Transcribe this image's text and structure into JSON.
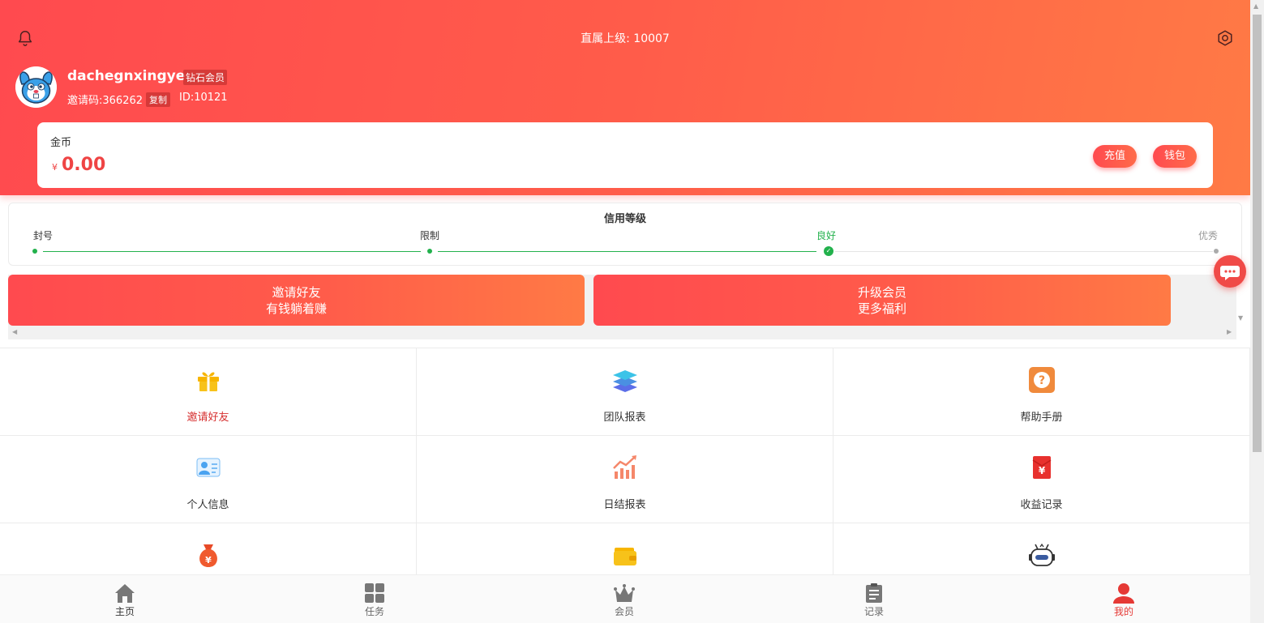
{
  "header": {
    "superior": "直属上级: 10007",
    "username": "dachegnxingye",
    "vip_badge": "钻石会员",
    "invite_code": "邀请码:366262",
    "copy_label": "复制",
    "user_id": "ID:10121"
  },
  "coin": {
    "label": "金币",
    "currency": "¥",
    "amount": "0.00",
    "recharge_label": "充值",
    "wallet_label": "钱包"
  },
  "credit": {
    "title": "信用等级",
    "levels": [
      "封号",
      "限制",
      "良好",
      "优秀"
    ],
    "current_level_index": 2
  },
  "banners": [
    {
      "line1": "邀请好友",
      "line2": "有钱躺着赚"
    },
    {
      "line1": "升级会员",
      "line2": "更多福利"
    }
  ],
  "menu": [
    {
      "label": "邀请好友",
      "icon": "gift-icon"
    },
    {
      "label": "团队报表",
      "icon": "layers-icon"
    },
    {
      "label": "帮助手册",
      "icon": "help-icon"
    },
    {
      "label": "个人信息",
      "icon": "id-card-icon"
    },
    {
      "label": "日结报表",
      "icon": "chart-up-icon"
    },
    {
      "label": "收益记录",
      "icon": "red-envelope-icon"
    },
    {
      "label": "",
      "icon": "money-bag-icon"
    },
    {
      "label": "",
      "icon": "wallet-icon"
    },
    {
      "label": "",
      "icon": "robot-icon"
    }
  ],
  "tabbar": [
    {
      "label": "主页",
      "icon": "home-icon"
    },
    {
      "label": "任务",
      "icon": "grid-icon"
    },
    {
      "label": "会员",
      "icon": "crown-icon"
    },
    {
      "label": "记录",
      "icon": "clipboard-icon"
    },
    {
      "label": "我的",
      "icon": "user-icon"
    }
  ],
  "colors": {
    "primary": "#ff4a4f",
    "gradient_end": "#ff7a45",
    "credit_green": "#22b14c",
    "active_tab": "#e53935"
  }
}
